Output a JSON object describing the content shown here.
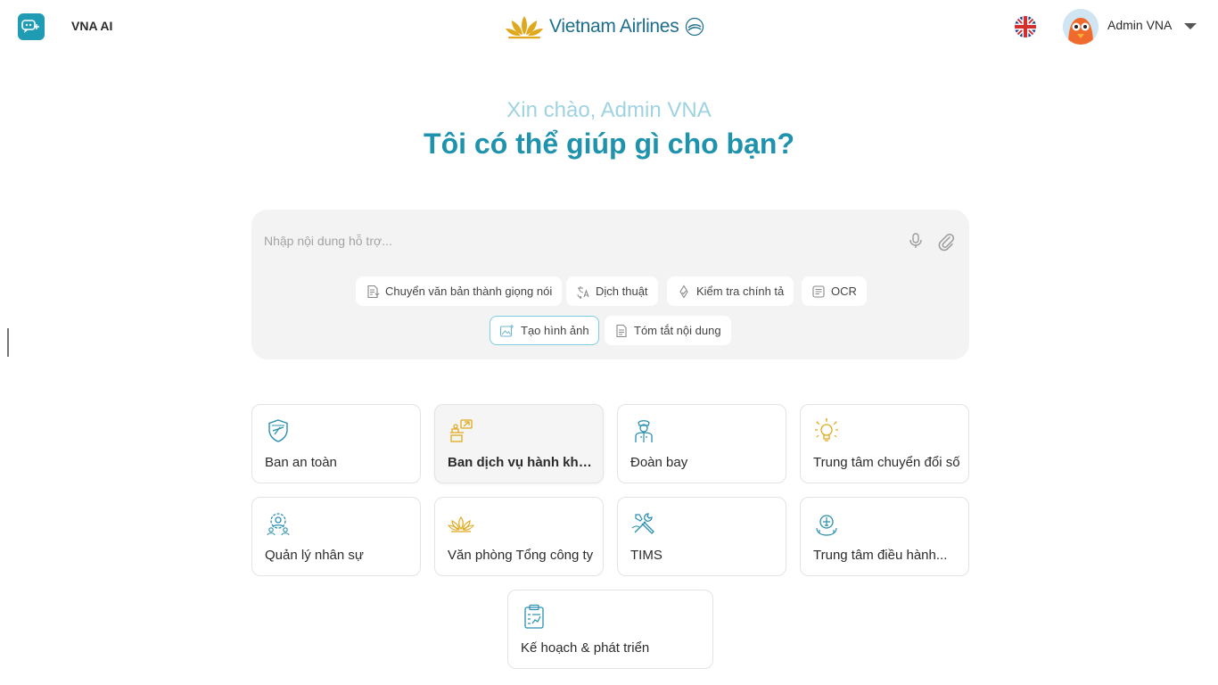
{
  "header": {
    "app_name": "VNA AI",
    "brand_name": "Vietnam Airlines",
    "language_icon": "uk-flag-icon",
    "user_name": "Admin VNA"
  },
  "hero": {
    "greeting": "Xin chào, Admin VNA",
    "headline": "Tôi có thể giúp gì cho bạn?"
  },
  "prompt": {
    "placeholder": "Nhập nội dung hỗ trợ...",
    "chips": [
      {
        "label": "Chuyển văn bản thành giọng nói",
        "icon": "text-to-speech-icon"
      },
      {
        "label": "Dịch thuật",
        "icon": "translate-icon"
      },
      {
        "label": "Kiểm tra chính tả",
        "icon": "spell-check-icon"
      },
      {
        "label": "OCR",
        "icon": "ocr-icon"
      },
      {
        "label": "Tạo hình ảnh",
        "icon": "image-generate-icon",
        "active": true
      },
      {
        "label": "Tóm tắt nội dung",
        "icon": "summary-icon"
      }
    ]
  },
  "departments": [
    {
      "label": "Ban an toàn",
      "icon": "shield-icon"
    },
    {
      "label": "Ban dịch vụ hành khách",
      "icon": "passenger-service-icon",
      "highlighted": true
    },
    {
      "label": "Đoàn bay",
      "icon": "pilot-icon"
    },
    {
      "label": "Trung tâm chuyển đổi số",
      "icon": "digital-bulb-icon"
    },
    {
      "label": "Quản lý nhân sự",
      "icon": "hr-gear-icon"
    },
    {
      "label": "Văn phòng Tổng công ty",
      "icon": "lotus-icon"
    },
    {
      "label": "TIMS",
      "icon": "tools-icon"
    },
    {
      "label": "Trung tâm điều hành...",
      "icon": "control-tower-icon"
    },
    {
      "label": "Kế hoạch & phát triển",
      "icon": "clipboard-chart-icon"
    }
  ],
  "colors": {
    "accent": "#1f93ad",
    "greeting": "#9fd3e1",
    "gold": "#e0a81c",
    "brand_blue": "#1c6e8c"
  }
}
